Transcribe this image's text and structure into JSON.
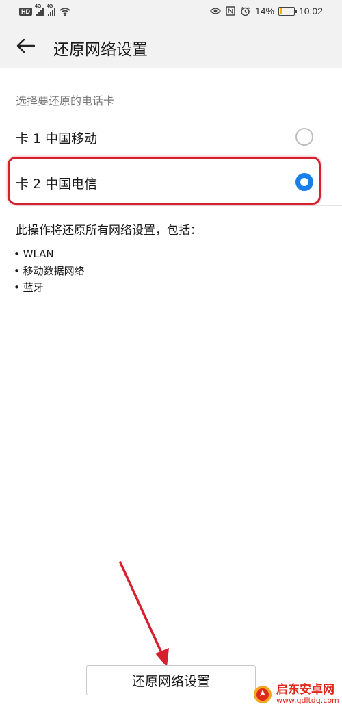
{
  "status_bar": {
    "left_icons": [
      "hd-icon",
      "signal-4g-icon",
      "signal-4g-icon",
      "wifi-icon"
    ],
    "signal_tag": "4G",
    "hd_label": "HD",
    "right_icons": [
      "eye-icon",
      "nfc-icon",
      "alarm-icon"
    ],
    "battery_percent": "14%",
    "battery_level": 0.14,
    "time": "10:02"
  },
  "app_bar": {
    "back_icon": "arrow-left-icon",
    "title": "还原网络设置"
  },
  "sim_select": {
    "label": "选择要还原的电话卡",
    "options": [
      {
        "label": "卡 1 中国移动",
        "selected": false
      },
      {
        "label": "卡 2 中国电信",
        "selected": true
      }
    ]
  },
  "info": {
    "description": "此操作将还原所有网络设置，包括：",
    "items": [
      "WLAN",
      "移动数据网络",
      "蓝牙"
    ]
  },
  "action": {
    "reset_button_label": "还原网络设置"
  },
  "colors": {
    "accent": "#1a7fe8",
    "annotation_red": "#d6202e",
    "bar_background": "#f2f2f2"
  },
  "watermark": {
    "name": "启东安卓网",
    "url": "www.qdltdq.com"
  }
}
